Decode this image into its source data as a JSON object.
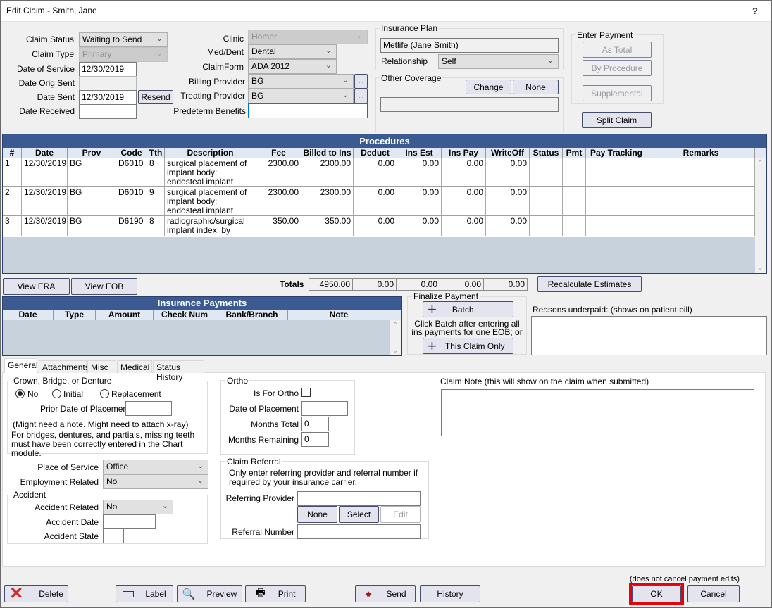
{
  "window": {
    "title": "Edit Claim - Smith, Jane",
    "help": "?"
  },
  "claim": {
    "status_label": "Claim Status",
    "status_value": "Waiting to Send",
    "type_label": "Claim Type",
    "type_value": "Primary",
    "date_service_label": "Date of Service",
    "date_service_value": "12/30/2019",
    "date_orig_sent_label": "Date Orig Sent",
    "date_orig_sent_value": "",
    "date_sent_label": "Date Sent",
    "date_sent_value": "12/30/2019",
    "resend_label": "Resend",
    "date_received_label": "Date Received",
    "date_received_value": "",
    "clinic_label": "Clinic",
    "clinic_value": "Homer",
    "meddent_label": "Med/Dent",
    "meddent_value": "Dental",
    "claimform_label": "ClaimForm",
    "claimform_value": "ADA 2012",
    "billing_label": "Billing Provider",
    "billing_value": "BG",
    "treating_label": "Treating Provider",
    "treating_value": "BG",
    "ellipsis": "...",
    "predeterm_label": "Predeterm Benefits",
    "predeterm_value": ""
  },
  "insurance": {
    "plan_title": "Insurance Plan",
    "plan_value": "Metlife (Jane Smith)",
    "relationship_label": "Relationship",
    "relationship_value": "Self",
    "other_title": "Other Coverage",
    "change_label": "Change",
    "none_label": "None",
    "other_value": ""
  },
  "enter_payment": {
    "title": "Enter Payment",
    "as_total": "As Total",
    "by_procedure": "By Procedure",
    "supplemental": "Supplemental",
    "split_claim": "Split Claim"
  },
  "procedures": {
    "title": "Procedures",
    "columns": [
      "#",
      "Date",
      "Prov",
      "Code",
      "Tth",
      "Description",
      "Fee",
      "Billed to Ins",
      "Deduct",
      "Ins Est",
      "Ins Pay",
      "WriteOff",
      "Status",
      "Pmt",
      "Pay Tracking",
      "Remarks"
    ],
    "rows": [
      {
        "num": "1",
        "date": "12/30/2019",
        "prov": "BG",
        "code": "D6010",
        "tth": "8",
        "desc": "surgical placement of implant body: endosteal implant",
        "fee": "2300.00",
        "billed": "2300.00",
        "deduct": "0.00",
        "insest": "0.00",
        "inspay": "0.00",
        "writeoff": "0.00",
        "status": "",
        "pmt": "",
        "paytracking": "",
        "remarks": ""
      },
      {
        "num": "2",
        "date": "12/30/2019",
        "prov": "BG",
        "code": "D6010",
        "tth": "9",
        "desc": "surgical placement of implant body: endosteal implant",
        "fee": "2300.00",
        "billed": "2300.00",
        "deduct": "0.00",
        "insest": "0.00",
        "inspay": "0.00",
        "writeoff": "0.00",
        "status": "",
        "pmt": "",
        "paytracking": "",
        "remarks": ""
      },
      {
        "num": "3",
        "date": "12/30/2019",
        "prov": "BG",
        "code": "D6190",
        "tth": "8",
        "desc": "radiographic/surgical implant index, by report",
        "fee": "350.00",
        "billed": "350.00",
        "deduct": "0.00",
        "insest": "0.00",
        "inspay": "0.00",
        "writeoff": "0.00",
        "status": "",
        "pmt": "",
        "paytracking": "",
        "remarks": ""
      }
    ],
    "totals_label": "Totals",
    "totals": [
      "4950.00",
      "0.00",
      "0.00",
      "0.00",
      "0.00"
    ]
  },
  "buttons": {
    "view_era": "View ERA",
    "view_eob": "View EOB",
    "recalc": "Recalculate Estimates"
  },
  "payments": {
    "title": "Insurance Payments",
    "columns": [
      "Date",
      "Type",
      "Amount",
      "Check Num",
      "Bank/Branch",
      "Note"
    ]
  },
  "finalize": {
    "title": "Finalize Payment",
    "batch": "Batch",
    "hint": "Click Batch after entering all ins payments for one EOB; or",
    "this_claim": "This Claim Only"
  },
  "underpaid": {
    "label": "Reasons underpaid:  (shows on patient bill)",
    "value": ""
  },
  "tabs": [
    {
      "label": "General",
      "active": true
    },
    {
      "label": "Attachments"
    },
    {
      "label": "Misc"
    },
    {
      "label": "Medical"
    },
    {
      "label": "Status History"
    }
  ],
  "general": {
    "crown_title": "Crown, Bridge, or Denture",
    "radio_no": "No",
    "radio_initial": "Initial",
    "radio_replacement": "Replacement",
    "selected": "No",
    "prior_date_label": "Prior Date of Placement",
    "prior_date_value": "",
    "note1": "(Might need a note. Might need to attach x-ray)",
    "note2": "For bridges, dentures, and partials, missing teeth must have been correctly entered in the Chart module.",
    "pos_label": "Place of Service",
    "pos_value": "Office",
    "employment_label": "Employment Related",
    "employment_value": "No",
    "accident_title": "Accident",
    "accident_related_label": "Accident Related",
    "accident_related_value": "No",
    "accident_date_label": "Accident Date",
    "accident_date_value": "",
    "accident_state_label": "Accident State",
    "accident_state_value": "",
    "ortho_title": "Ortho",
    "is_ortho_label": "Is For Ortho",
    "is_ortho_checked": false,
    "ortho_date_label": "Date of Placement",
    "ortho_date_value": "",
    "months_total_label": "Months Total",
    "months_total_value": "0",
    "months_remaining_label": "Months Remaining",
    "months_remaining_value": "0",
    "referral_title": "Claim Referral",
    "referral_note": "Only enter referring provider and referral number if required by your insurance carrier.",
    "ref_provider_label": "Referring Provider",
    "ref_provider_value": "",
    "ref_none": "None",
    "ref_select": "Select",
    "ref_edit": "Edit",
    "ref_number_label": "Referral Number",
    "ref_number_value": "",
    "claim_note_label": "Claim Note (this will show on the claim when submitted)",
    "claim_note_value": ""
  },
  "footer": {
    "delete": "Delete",
    "label": "Label",
    "preview": "Preview",
    "print": "Print",
    "send": "Send",
    "history": "History",
    "cancel_note": "(does not cancel payment edits)",
    "ok": "OK",
    "cancel": "Cancel",
    "highlight_color": "#e8000b"
  }
}
